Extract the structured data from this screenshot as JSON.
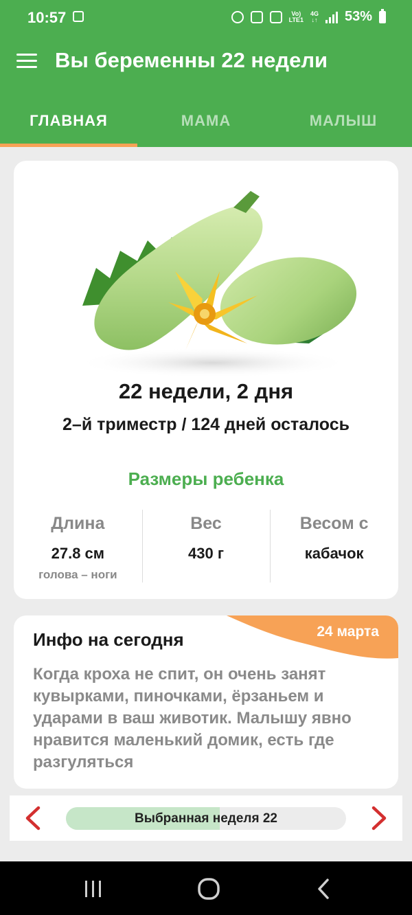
{
  "status": {
    "time": "10:57",
    "lte_top": "Vo)",
    "lte_bottom": "LTE1",
    "net_top": "4G",
    "battery": "53%"
  },
  "appbar": {
    "title": "Вы беременны 22 недели"
  },
  "tabs": [
    {
      "label": "ГЛАВНАЯ",
      "active": true
    },
    {
      "label": "МАМА",
      "active": false
    },
    {
      "label": "МАЛЫШ",
      "active": false
    }
  ],
  "summary": {
    "week_title": "22 недели, 2 дня",
    "trimester": "2–й триместр / 124 дней осталось",
    "sizes_title": "Размеры ребенка",
    "stats": [
      {
        "label": "Длина",
        "value": "27.8 см",
        "sub": "голова – ноги"
      },
      {
        "label": "Вес",
        "value": "430 г",
        "sub": ""
      },
      {
        "label": "Весом с",
        "value": "кабачок",
        "sub": ""
      }
    ]
  },
  "info": {
    "title": "Инфо на сегодня",
    "date": "24 марта",
    "text": "Когда кроха не спит, он очень занят кувырками, пиночками, ёрзаньем и ударами в ваш животик. Малышу явно нравится маленький домик, есть где разгуляться"
  },
  "week_nav": {
    "label": "Выбранная неделя 22",
    "progress": 0.55
  },
  "colors": {
    "primary": "#4cae50",
    "accent": "#f7a256",
    "arrow": "#d32f2f"
  }
}
